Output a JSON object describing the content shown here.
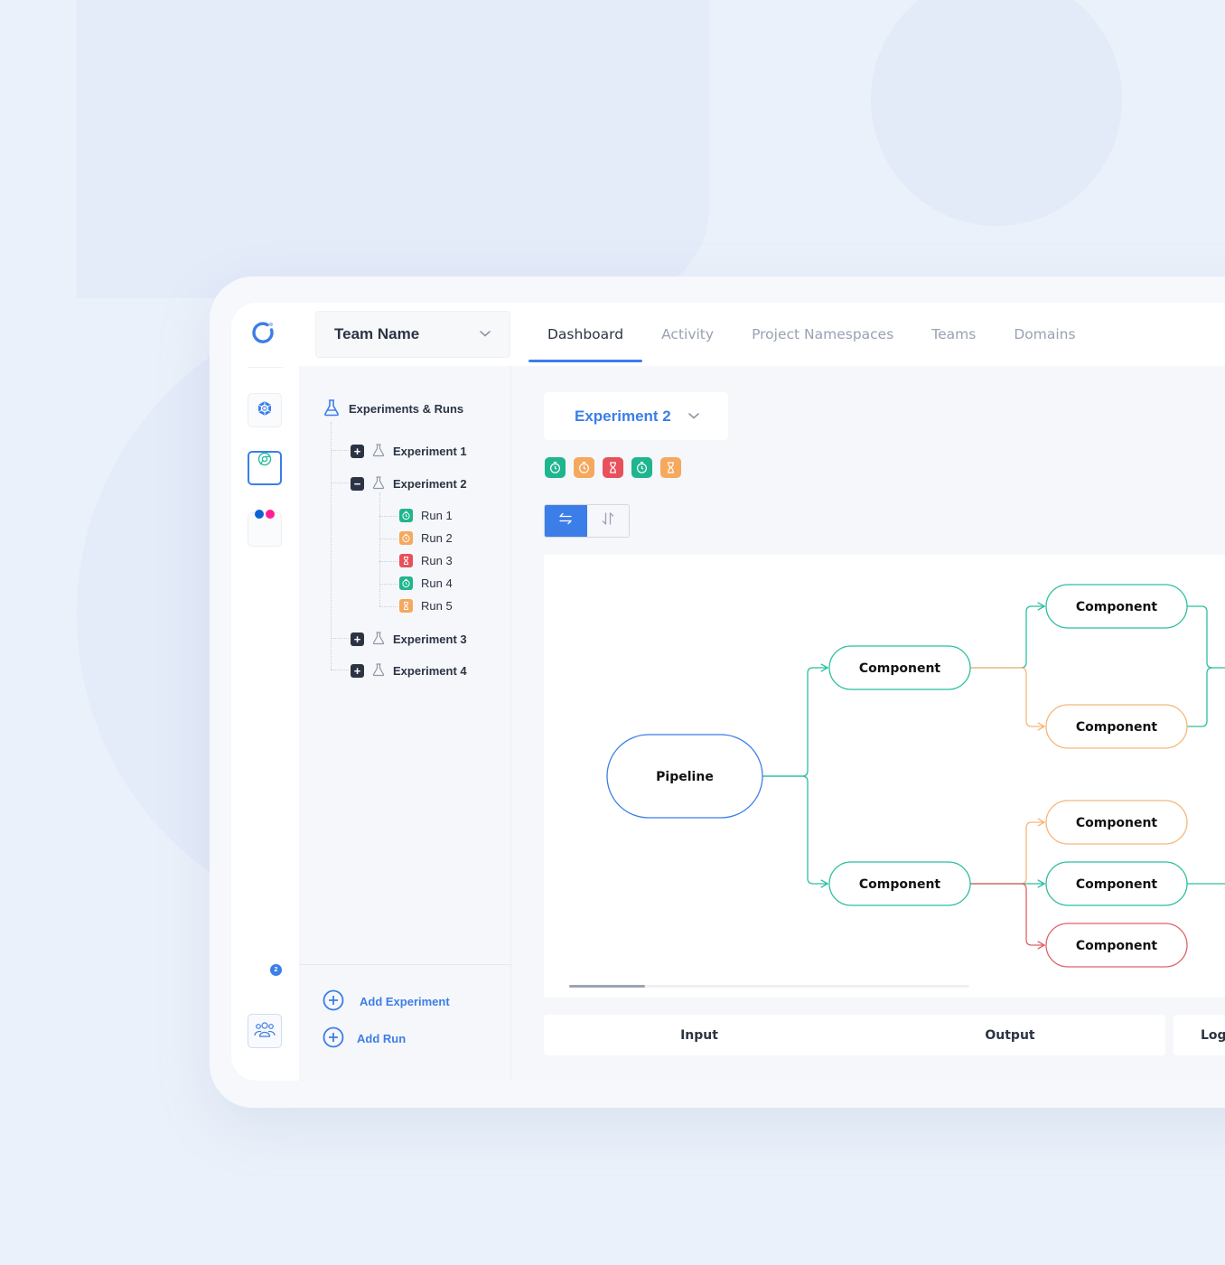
{
  "topbar": {
    "team_select": {
      "label": "Team Name"
    },
    "tabs": [
      {
        "label": "Dashboard",
        "active": true
      },
      {
        "label": "Activity"
      },
      {
        "label": "Project Namespaces"
      },
      {
        "label": "Teams"
      },
      {
        "label": "Domains"
      }
    ]
  },
  "rail": {
    "items": [
      {
        "icon": "kubernetes-icon"
      },
      {
        "icon": "chrome-icon",
        "active": true
      },
      {
        "icon": "flickr-icon"
      }
    ],
    "badge_count": "2",
    "bottom_icon": "team-icon"
  },
  "tree": {
    "header": "Experiments & Runs",
    "experiments": [
      {
        "label": "Experiment 1",
        "expanded": false
      },
      {
        "label": "Experiment 2",
        "expanded": true,
        "runs": [
          {
            "label": "Run 1",
            "status": "timer",
            "color": "#1fb58f"
          },
          {
            "label": "Run 2",
            "status": "timer",
            "color": "#f5a85e"
          },
          {
            "label": "Run 3",
            "status": "hourglass",
            "color": "#e8505b"
          },
          {
            "label": "Run 4",
            "status": "timer",
            "color": "#1fb58f"
          },
          {
            "label": "Run 5",
            "status": "hourglass",
            "color": "#f5a85e"
          }
        ]
      },
      {
        "label": "Experiment 3",
        "expanded": false
      },
      {
        "label": "Experiment 4",
        "expanded": false
      }
    ],
    "toggle_plus": "+",
    "toggle_minus": "−",
    "footer": {
      "add_experiment": "Add Experiment",
      "add_run": "Add Run"
    }
  },
  "main": {
    "experiment_select": {
      "label": "Experiment 2"
    },
    "status_icons": [
      {
        "status": "timer",
        "color": "#1fb58f"
      },
      {
        "status": "timer",
        "color": "#f5a85e"
      },
      {
        "status": "hourglass",
        "color": "#e8505b"
      },
      {
        "status": "timer",
        "color": "#1fb58f"
      },
      {
        "status": "hourglass",
        "color": "#f5a85e"
      }
    ],
    "orientation": {
      "horizontal_active": true
    },
    "graph": {
      "root": {
        "label": "Pipeline",
        "color": "#3b7ee8"
      },
      "nodes": [
        {
          "id": "c1",
          "label": "Component",
          "color": "#2bbf9f"
        },
        {
          "id": "c2",
          "label": "Component",
          "color": "#2bbf9f"
        },
        {
          "id": "c1a",
          "label": "Component",
          "color": "#2bbf9f"
        },
        {
          "id": "c1b",
          "label": "Component",
          "color": "#f5b77a"
        },
        {
          "id": "c2a",
          "label": "Component",
          "color": "#f5b77a"
        },
        {
          "id": "c2b",
          "label": "Component",
          "color": "#2bbf9f"
        },
        {
          "id": "c2c",
          "label": "Component",
          "color": "#e06068"
        }
      ]
    },
    "scroll_fraction": 0.19,
    "io_tabs": {
      "input": "Input",
      "output": "Output",
      "log": "Log"
    }
  },
  "colors": {
    "accent": "#3b7ee8",
    "success": "#1fb58f",
    "warning": "#f5a85e",
    "danger": "#e8505b",
    "text": "#2b3445",
    "muted": "#98a2b3"
  }
}
